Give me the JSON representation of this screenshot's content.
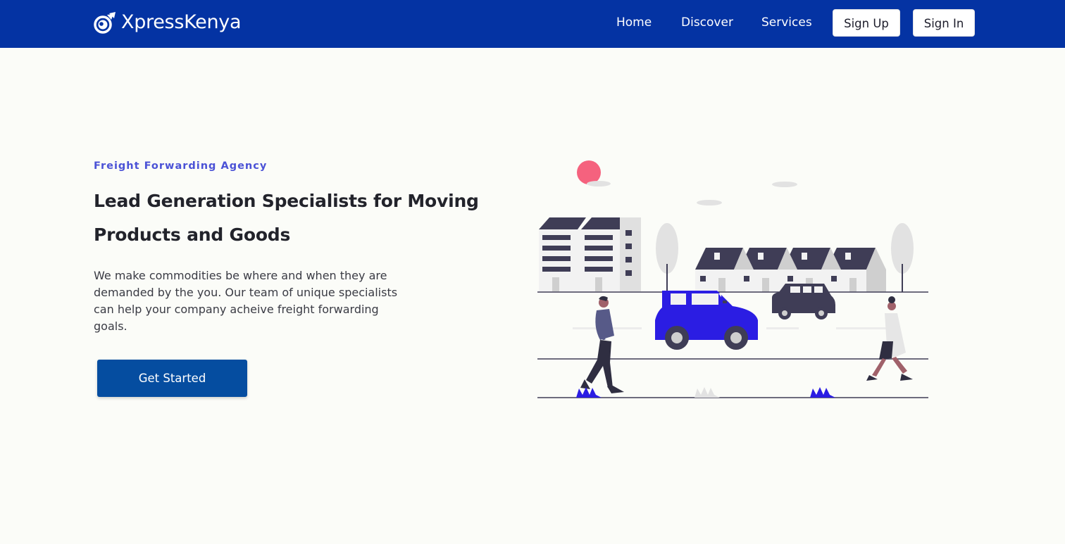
{
  "nav": {
    "brand": "XpressKenya",
    "links": [
      "Home",
      "Discover",
      "Services"
    ],
    "sign_up": "Sign Up",
    "sign_in": "Sign In"
  },
  "hero": {
    "eyebrow": "Freight Forwarding Agency",
    "headline": "Lead Generation Specialists for Moving Products and Goods",
    "description": "We make commodities be where and when they are demanded by the you. Our team of unique specialists can help your company acheive freight forwarding goals.",
    "cta_label": "Get Started"
  },
  "colors": {
    "navbar": "#0433a3",
    "background": "#fbfcf8",
    "accent": "#4b52d6",
    "cta": "#054da0",
    "illustration_primary": "#2b1de3",
    "illustration_dark": "#3f3d56"
  },
  "icons": {
    "brand": "comet-eye-logo-icon"
  }
}
